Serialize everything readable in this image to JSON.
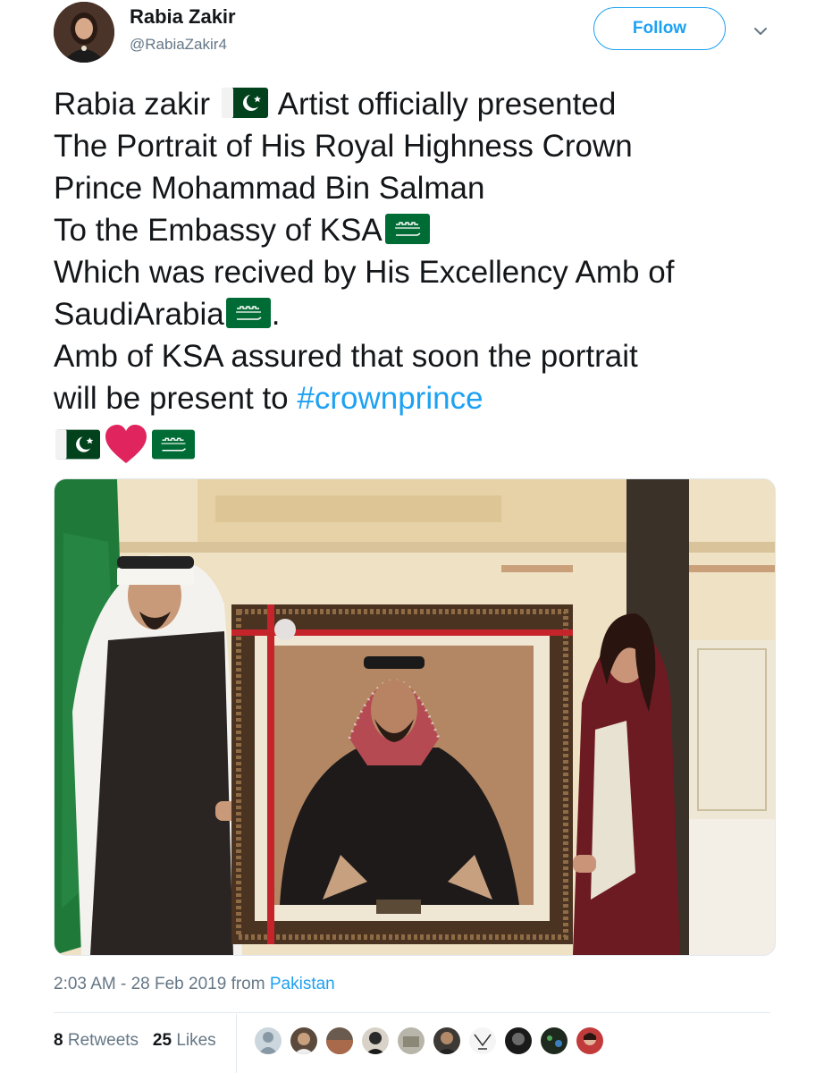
{
  "author": {
    "name": "Rabia Zakir",
    "handle": "@RabiaZakir4",
    "avatar_icon": "profile-photo"
  },
  "follow_label": "Follow",
  "tweet": {
    "line1_a": "Rabia zakir",
    "line1_b": "Artist officially presented",
    "line2": "The Portrait of His Royal Highness Crown",
    "line3": "Prince Mohammad Bin Salman",
    "line4": "To the Embassy of KSA",
    "line5": "Which was recived by His Excellency Amb of",
    "line6_a": "SaudiArabia",
    "line6_b": ".",
    "line7": "Amb of KSA assured that soon the portrait",
    "line8_a": "will be present to ",
    "hashtag": "#crownprince",
    "emojis": [
      "pakistan-flag",
      "red-heart",
      "saudi-flag"
    ]
  },
  "media": {
    "description_icon": "photo-portrait-presentation"
  },
  "meta": {
    "time": "2:03 AM - 28 Feb 2019",
    "from": " from ",
    "location": "Pakistan"
  },
  "stats": {
    "retweets_count": "8",
    "retweets_label": "Retweets",
    "likes_count": "25",
    "likes_label": "Likes"
  },
  "colors": {
    "link": "#1da1f2",
    "text": "#14171a",
    "muted": "#657786",
    "pakistan_green": "#01411c",
    "saudi_green": "#006c35",
    "heart": "#e0245e"
  }
}
